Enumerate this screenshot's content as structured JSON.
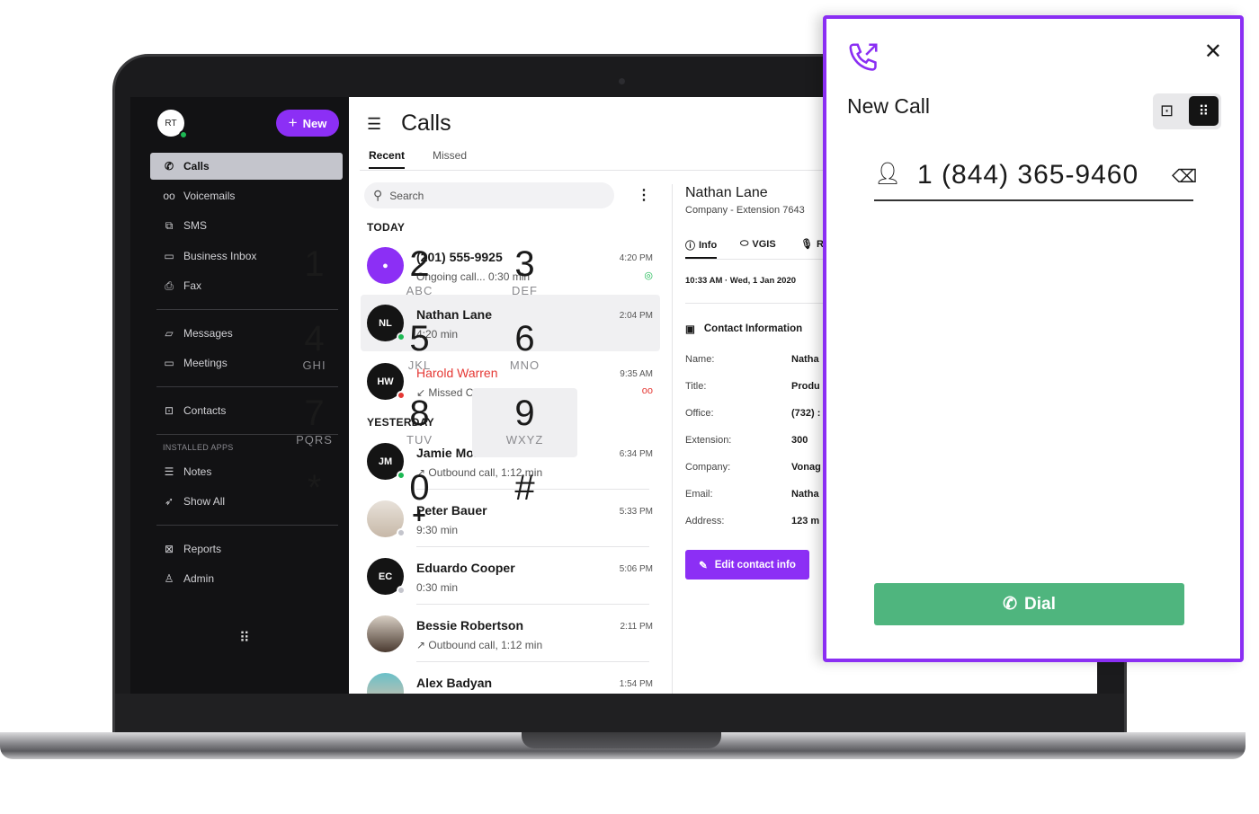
{
  "sidebar": {
    "avatar_initials": "RT",
    "new_label": "New",
    "items": [
      {
        "label": "Calls",
        "icon": "phone-icon",
        "active": true
      },
      {
        "label": "Voicemails",
        "icon": "voicemail-icon"
      },
      {
        "label": "SMS",
        "icon": "sms-icon"
      },
      {
        "label": "Business Inbox",
        "icon": "inbox-icon"
      },
      {
        "label": "Fax",
        "icon": "printer-icon"
      },
      {
        "label": "Messages",
        "icon": "chat-icon"
      },
      {
        "label": "Meetings",
        "icon": "video-icon"
      },
      {
        "label": "Contacts",
        "icon": "contact-card-icon"
      },
      {
        "label": "Notes",
        "icon": "notes-icon"
      },
      {
        "label": "Show All",
        "icon": "rocket-icon"
      },
      {
        "label": "Reports",
        "icon": "chart-icon"
      },
      {
        "label": "Admin",
        "icon": "admin-icon"
      }
    ],
    "installed_apps_label": "INSTALLED APPS"
  },
  "calls": {
    "title": "Calls",
    "tabs": [
      "Recent",
      "Missed"
    ],
    "search_placeholder": "Search",
    "today_label": "TODAY",
    "yesterday_label": "YESTERDAY",
    "today": [
      {
        "name": "(201) 555-9925",
        "sub": "Ongoing call... 0:30 min",
        "time": "4:20 PM",
        "status": "ongoing"
      },
      {
        "initials": "NL",
        "name": "Nathan Lane",
        "sub": "4:20 min",
        "time": "2:04 PM",
        "presence": "online"
      },
      {
        "initials": "HW",
        "name": "Harold Warren",
        "sub": "Missed Call",
        "time": "9:35 AM",
        "presence": "busy",
        "missed": true
      }
    ],
    "yesterday": [
      {
        "initials": "JM",
        "name": "Jamie Morrison",
        "sub": "Outbound call, 1:12 min",
        "time": "6:34 PM",
        "presence": "online"
      },
      {
        "name": "Peter Bauer",
        "sub": "9:30 min",
        "time": "5:33 PM",
        "presence": "offline"
      },
      {
        "initials": "EC",
        "name": "Eduardo Cooper",
        "sub": "0:30 min",
        "time": "5:06 PM",
        "presence": "offline"
      },
      {
        "name": "Bessie Robertson",
        "sub": "Outbound call, 1:12 min",
        "time": "2:11 PM"
      },
      {
        "name": "Alex Badyan",
        "time": "1:54 PM"
      }
    ]
  },
  "detail": {
    "name": "Nathan Lane",
    "sub": "Company -  Extension 7643",
    "tabs": [
      "Info",
      "VGIS",
      "R"
    ],
    "date": "10:33 AM  ·  Wed, 1 Jan 2020",
    "section": "Contact Information",
    "fields": [
      {
        "label": "Name:",
        "value": "Natha"
      },
      {
        "label": "Title:",
        "value": "Produ"
      },
      {
        "label": "Office:",
        "value": "(732) :"
      },
      {
        "label": "Extension:",
        "value": "300"
      },
      {
        "label": "Company:",
        "value": "Vonag"
      },
      {
        "label": "Email:",
        "value": "Natha"
      },
      {
        "label": "Address:",
        "value": "123 m"
      }
    ],
    "edit_label": "Edit contact info"
  },
  "dialer": {
    "title": "New Call",
    "number": "1 (844) 365-9460",
    "keys": [
      {
        "d": "1",
        "l": ""
      },
      {
        "d": "2",
        "l": "ABC"
      },
      {
        "d": "3",
        "l": "DEF"
      },
      {
        "d": "4",
        "l": "GHI"
      },
      {
        "d": "5",
        "l": "JKL"
      },
      {
        "d": "6",
        "l": "MNO"
      },
      {
        "d": "7",
        "l": "PQRS"
      },
      {
        "d": "8",
        "l": "TUV"
      },
      {
        "d": "9",
        "l": "WXYZ"
      },
      {
        "d": "*",
        "l": ""
      },
      {
        "d": "0",
        "l": "+"
      },
      {
        "d": "#",
        "l": ""
      }
    ],
    "dial_label": "Dial",
    "colors": {
      "accent": "#8a2ef3",
      "dial": "#4fb57e"
    }
  }
}
